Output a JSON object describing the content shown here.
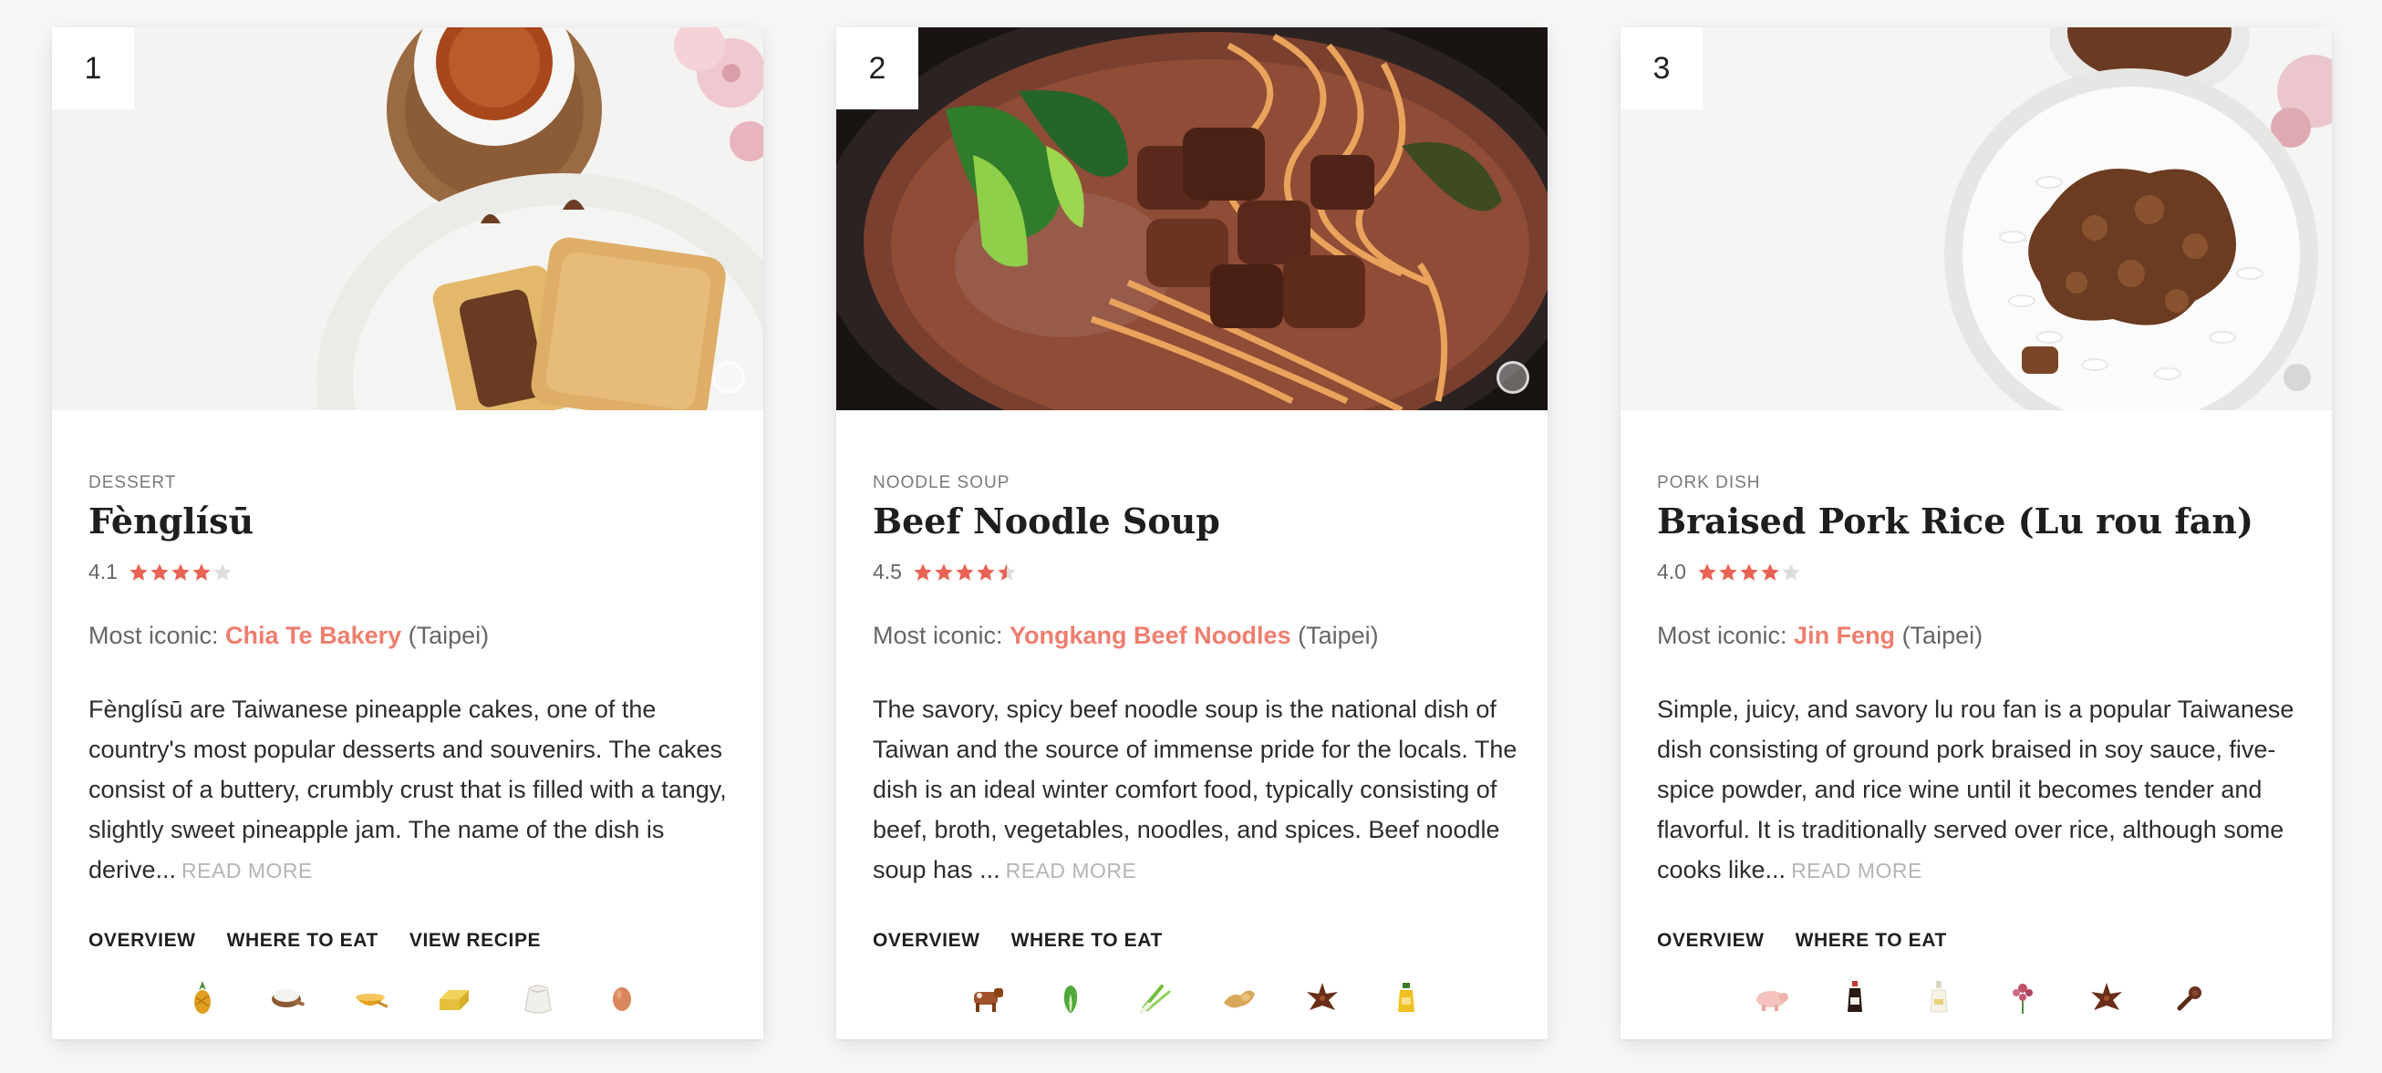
{
  "accent_color": "#ee7e6f",
  "star_color": "#e86355",
  "cards": [
    {
      "rank": "1",
      "category": "DESSERT",
      "title": "Fènglísū",
      "rating": "4.1",
      "rating_value": 4.1,
      "iconic_prefix": "Most iconic: ",
      "iconic_place": "Chia Te Bakery",
      "iconic_city": " (Taipei)",
      "description": "Fènglísū are Taiwanese pineapple cakes, one of the country's most popular desserts and souvenirs. The cakes consist of a buttery, crumbly crust that is filled with a tangy, slightly sweet pineapple jam. The name of the dish is derive...",
      "read_more": "READ MORE",
      "tabs": [
        "OVERVIEW",
        "WHERE TO EAT",
        "VIEW RECIPE"
      ],
      "ingredients": [
        "pineapple-icon",
        "flour-icon",
        "sugar-icon",
        "butter-icon",
        "flour-sack-icon",
        "egg-icon"
      ]
    },
    {
      "rank": "2",
      "category": "NOODLE SOUP",
      "title": "Beef Noodle Soup",
      "rating": "4.5",
      "rating_value": 4.5,
      "iconic_prefix": "Most iconic: ",
      "iconic_place": "Yongkang Beef Noodles",
      "iconic_city": " (Taipei)",
      "description": "The savory, spicy beef noodle soup is the national dish of Taiwan and the source of immense pride for the locals. The dish is an ideal winter comfort food, typically consisting of beef, broth, vegetables, noodles, and spices. Beef noodle soup has ...",
      "read_more": "READ MORE",
      "tabs": [
        "OVERVIEW",
        "WHERE TO EAT"
      ],
      "ingredients": [
        "cow-icon",
        "bok-choy-icon",
        "scallion-icon",
        "ginger-icon",
        "star-anise-icon",
        "oil-bottle-icon"
      ]
    },
    {
      "rank": "3",
      "category": "PORK DISH",
      "title": "Braised Pork Rice (Lu rou fan)",
      "rating": "4.0",
      "rating_value": 4.0,
      "iconic_prefix": "Most iconic: ",
      "iconic_place": "Jin Feng",
      "iconic_city": " (Taipei)",
      "description": "Simple, juicy, and savory lu rou fan is a popular Taiwanese dish consisting of ground pork braised in soy sauce, five-spice powder, and rice wine until it becomes tender and flavorful. It is traditionally served over rice, although some cooks like...",
      "read_more": "READ MORE",
      "tabs": [
        "OVERVIEW",
        "WHERE TO EAT"
      ],
      "ingredients": [
        "pig-icon",
        "soy-sauce-icon",
        "rice-wine-icon",
        "five-spice-icon",
        "star-anise-icon",
        "clove-icon"
      ]
    }
  ]
}
